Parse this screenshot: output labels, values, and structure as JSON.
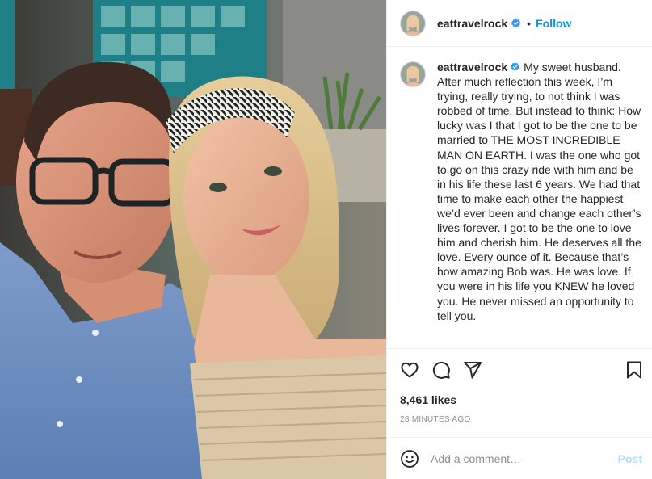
{
  "header": {
    "username": "eattravelrock",
    "separator": "•",
    "follow_label": "Follow"
  },
  "caption": {
    "username": "eattravelrock",
    "text": "My sweet husband. After much reflection this week, I’m trying, really trying, to not think I was robbed of time. But instead to think: How lucky was I that I got to be the one to be married to THE MOST INCREDIBLE MAN ON EARTH. I was the one who got to go on this crazy ride with him and be in his life these last 6 years. We had that time to make each other the happiest we’d ever been and change each other’s lives forever. I got to be the one to love him and cherish him. He deserves all the love. Every ounce of it. Because that’s how amazing Bob was. He was love. If you were in his life you KNEW he loved you. He never missed an opportunity to tell you."
  },
  "actions": {
    "icons": [
      "heart-icon",
      "comment-icon",
      "share-icon",
      "bookmark-icon"
    ]
  },
  "likes": "8,461 likes",
  "timestamp": "28 MINUTES AGO",
  "comment": {
    "placeholder": "Add a comment…",
    "post_label": "Post"
  },
  "colors": {
    "accent": "#0095f6",
    "post_disabled": "#b2dffc",
    "text": "#262626",
    "muted": "#8e8e8e",
    "border": "#efefef"
  }
}
